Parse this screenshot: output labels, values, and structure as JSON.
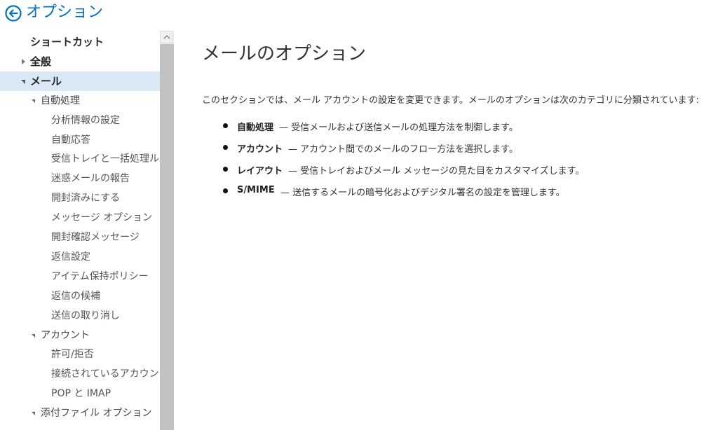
{
  "header": {
    "title": "オプション",
    "back_icon": "back-arrow-circle-icon",
    "accent_color": "#0072c6"
  },
  "nav": {
    "items": [
      {
        "label": "ショートカット",
        "level": 0,
        "expander": "none",
        "selected": false
      },
      {
        "label": "全般",
        "level": 0,
        "expander": "collapsed",
        "selected": false
      },
      {
        "label": "メール",
        "level": 0,
        "expander": "expanded",
        "selected": true
      },
      {
        "label": "自動処理",
        "level": 1,
        "expander": "expanded",
        "selected": false
      },
      {
        "label": "分析情報の設定",
        "level": 2,
        "expander": "none",
        "selected": false
      },
      {
        "label": "自動応答",
        "level": 2,
        "expander": "none",
        "selected": false
      },
      {
        "label": "受信トレイと一括処理ルー",
        "level": 2,
        "expander": "none",
        "selected": false
      },
      {
        "label": "迷惑メールの報告",
        "level": 2,
        "expander": "none",
        "selected": false
      },
      {
        "label": "開封済みにする",
        "level": 2,
        "expander": "none",
        "selected": false
      },
      {
        "label": "メッセージ オプション",
        "level": 2,
        "expander": "none",
        "selected": false
      },
      {
        "label": "開封確認メッセージ",
        "level": 2,
        "expander": "none",
        "selected": false
      },
      {
        "label": "返信設定",
        "level": 2,
        "expander": "none",
        "selected": false
      },
      {
        "label": "アイテム保持ポリシー",
        "level": 2,
        "expander": "none",
        "selected": false
      },
      {
        "label": "返信の候補",
        "level": 2,
        "expander": "none",
        "selected": false
      },
      {
        "label": "送信の取り消し",
        "level": 2,
        "expander": "none",
        "selected": false
      },
      {
        "label": "アカウント",
        "level": 1,
        "expander": "expanded",
        "selected": false
      },
      {
        "label": "許可/拒否",
        "level": 2,
        "expander": "none",
        "selected": false
      },
      {
        "label": "接続されているアカウント",
        "level": 2,
        "expander": "none",
        "selected": false
      },
      {
        "label": "POP と IMAP",
        "level": 2,
        "expander": "none",
        "selected": false
      },
      {
        "label": "添付ファイル オプション",
        "level": 1,
        "expander": "expanded",
        "selected": false
      }
    ],
    "selected_color": "#dae8f5"
  },
  "main": {
    "title": "メールのオプション",
    "intro": "このセクションでは、メール アカウントの設定を変更できます。メールのオプションは次のカテゴリに分類されています:",
    "bullets": [
      {
        "term": "自動処理",
        "desc": "— 受信メールおよび送信メールの処理方法を制御します。"
      },
      {
        "term": "アカウント",
        "desc": "— アカウント間でのメールのフロー方法を選択します。"
      },
      {
        "term": "レイアウト",
        "desc": "— 受信トレイおよびメール メッセージの見た目をカスタマイズします。"
      },
      {
        "term": "S/MIME",
        "desc": "— 送信するメールの暗号化およびデジタル署名の設定を管理します。"
      }
    ]
  }
}
